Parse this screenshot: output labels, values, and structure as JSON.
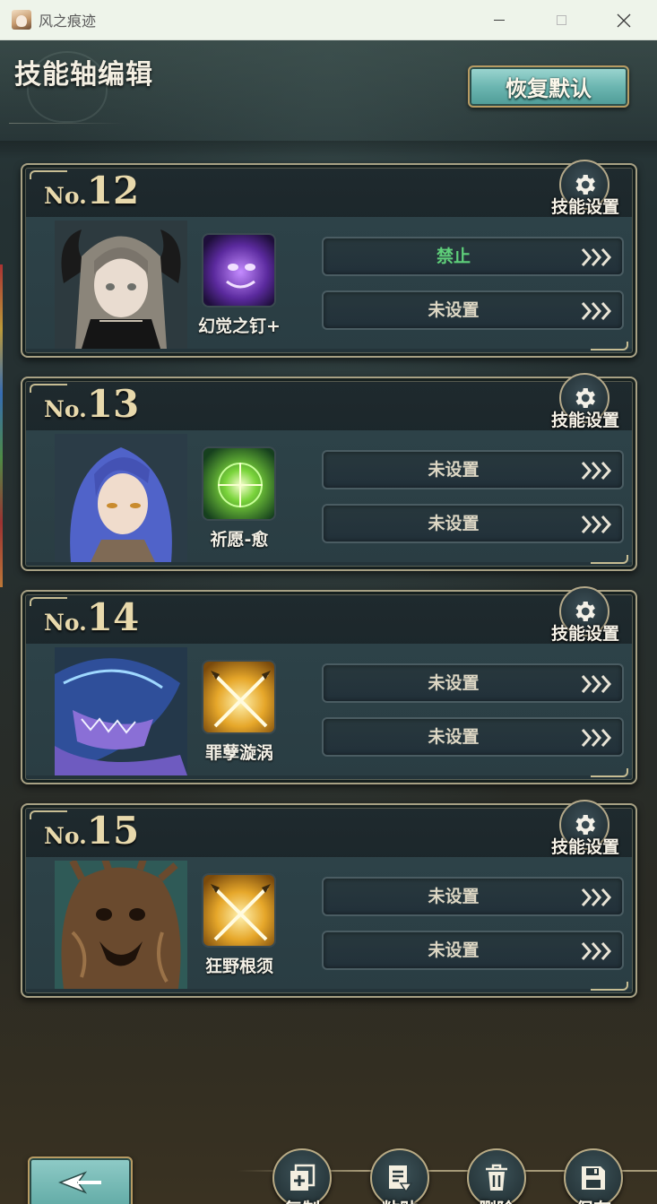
{
  "window": {
    "title": "风之痕迹"
  },
  "header": {
    "title": "技能轴编辑",
    "restore_label": "恢复默认"
  },
  "colors": {
    "accent_teal": "#6cb6b1",
    "gold_border": "#b79b63",
    "forbidden_green": "#5fd07a",
    "card_bg": "#1f2a2e"
  },
  "cards": [
    {
      "no_prefix": "No.",
      "number": "12",
      "settings_label": "技能设置",
      "portrait": "horned-girl-portrait",
      "skill_icon": "purple-phantom-icon",
      "skill_name": "幻觉之钉+",
      "slots": [
        {
          "label": "禁止",
          "state": "forbidden"
        },
        {
          "label": "未设置",
          "state": "unset"
        }
      ]
    },
    {
      "no_prefix": "No.",
      "number": "13",
      "settings_label": "技能设置",
      "portrait": "blue-haired-girl-portrait",
      "skill_icon": "green-heal-icon",
      "skill_name": "祈愿-愈",
      "slots": [
        {
          "label": "未设置",
          "state": "unset"
        },
        {
          "label": "未设置",
          "state": "unset"
        }
      ]
    },
    {
      "no_prefix": "No.",
      "number": "14",
      "settings_label": "技能设置",
      "portrait": "whale-creature-portrait",
      "skill_icon": "crossed-spears-icon",
      "skill_name": "罪孽漩涡",
      "slots": [
        {
          "label": "未设置",
          "state": "unset"
        },
        {
          "label": "未设置",
          "state": "unset"
        }
      ]
    },
    {
      "no_prefix": "No.",
      "number": "15",
      "settings_label": "技能设置",
      "portrait": "tree-monster-portrait",
      "skill_icon": "crossed-spears-icon",
      "skill_name": "狂野根须",
      "slots": [
        {
          "label": "未设置",
          "state": "unset"
        },
        {
          "label": "未设置",
          "state": "unset"
        }
      ]
    }
  ],
  "footer": {
    "back_icon": "back-arrow-icon",
    "actions": [
      {
        "label": "复制",
        "icon": "copy-icon"
      },
      {
        "label": "粘贴",
        "icon": "paste-icon"
      },
      {
        "label": "删除",
        "icon": "trash-icon"
      },
      {
        "label": "保存",
        "icon": "save-icon"
      }
    ]
  }
}
